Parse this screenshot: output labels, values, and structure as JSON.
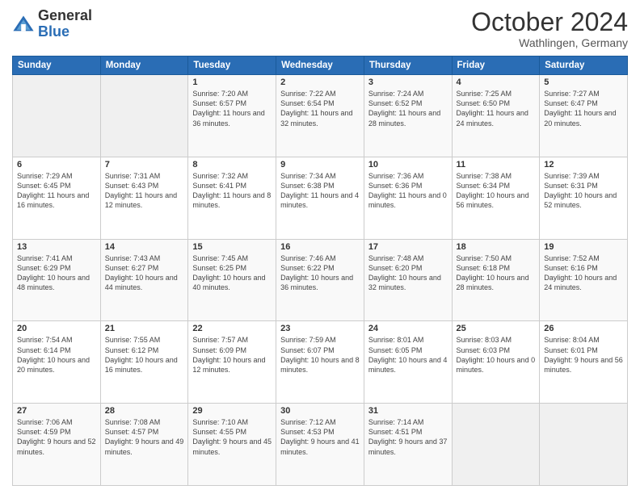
{
  "header": {
    "logo_general": "General",
    "logo_blue": "Blue",
    "month": "October 2024",
    "location": "Wathlingen, Germany"
  },
  "days_of_week": [
    "Sunday",
    "Monday",
    "Tuesday",
    "Wednesday",
    "Thursday",
    "Friday",
    "Saturday"
  ],
  "weeks": [
    [
      {
        "day": "",
        "info": ""
      },
      {
        "day": "",
        "info": ""
      },
      {
        "day": "1",
        "info": "Sunrise: 7:20 AM\nSunset: 6:57 PM\nDaylight: 11 hours and 36 minutes."
      },
      {
        "day": "2",
        "info": "Sunrise: 7:22 AM\nSunset: 6:54 PM\nDaylight: 11 hours and 32 minutes."
      },
      {
        "day": "3",
        "info": "Sunrise: 7:24 AM\nSunset: 6:52 PM\nDaylight: 11 hours and 28 minutes."
      },
      {
        "day": "4",
        "info": "Sunrise: 7:25 AM\nSunset: 6:50 PM\nDaylight: 11 hours and 24 minutes."
      },
      {
        "day": "5",
        "info": "Sunrise: 7:27 AM\nSunset: 6:47 PM\nDaylight: 11 hours and 20 minutes."
      }
    ],
    [
      {
        "day": "6",
        "info": "Sunrise: 7:29 AM\nSunset: 6:45 PM\nDaylight: 11 hours and 16 minutes."
      },
      {
        "day": "7",
        "info": "Sunrise: 7:31 AM\nSunset: 6:43 PM\nDaylight: 11 hours and 12 minutes."
      },
      {
        "day": "8",
        "info": "Sunrise: 7:32 AM\nSunset: 6:41 PM\nDaylight: 11 hours and 8 minutes."
      },
      {
        "day": "9",
        "info": "Sunrise: 7:34 AM\nSunset: 6:38 PM\nDaylight: 11 hours and 4 minutes."
      },
      {
        "day": "10",
        "info": "Sunrise: 7:36 AM\nSunset: 6:36 PM\nDaylight: 11 hours and 0 minutes."
      },
      {
        "day": "11",
        "info": "Sunrise: 7:38 AM\nSunset: 6:34 PM\nDaylight: 10 hours and 56 minutes."
      },
      {
        "day": "12",
        "info": "Sunrise: 7:39 AM\nSunset: 6:31 PM\nDaylight: 10 hours and 52 minutes."
      }
    ],
    [
      {
        "day": "13",
        "info": "Sunrise: 7:41 AM\nSunset: 6:29 PM\nDaylight: 10 hours and 48 minutes."
      },
      {
        "day": "14",
        "info": "Sunrise: 7:43 AM\nSunset: 6:27 PM\nDaylight: 10 hours and 44 minutes."
      },
      {
        "day": "15",
        "info": "Sunrise: 7:45 AM\nSunset: 6:25 PM\nDaylight: 10 hours and 40 minutes."
      },
      {
        "day": "16",
        "info": "Sunrise: 7:46 AM\nSunset: 6:22 PM\nDaylight: 10 hours and 36 minutes."
      },
      {
        "day": "17",
        "info": "Sunrise: 7:48 AM\nSunset: 6:20 PM\nDaylight: 10 hours and 32 minutes."
      },
      {
        "day": "18",
        "info": "Sunrise: 7:50 AM\nSunset: 6:18 PM\nDaylight: 10 hours and 28 minutes."
      },
      {
        "day": "19",
        "info": "Sunrise: 7:52 AM\nSunset: 6:16 PM\nDaylight: 10 hours and 24 minutes."
      }
    ],
    [
      {
        "day": "20",
        "info": "Sunrise: 7:54 AM\nSunset: 6:14 PM\nDaylight: 10 hours and 20 minutes."
      },
      {
        "day": "21",
        "info": "Sunrise: 7:55 AM\nSunset: 6:12 PM\nDaylight: 10 hours and 16 minutes."
      },
      {
        "day": "22",
        "info": "Sunrise: 7:57 AM\nSunset: 6:09 PM\nDaylight: 10 hours and 12 minutes."
      },
      {
        "day": "23",
        "info": "Sunrise: 7:59 AM\nSunset: 6:07 PM\nDaylight: 10 hours and 8 minutes."
      },
      {
        "day": "24",
        "info": "Sunrise: 8:01 AM\nSunset: 6:05 PM\nDaylight: 10 hours and 4 minutes."
      },
      {
        "day": "25",
        "info": "Sunrise: 8:03 AM\nSunset: 6:03 PM\nDaylight: 10 hours and 0 minutes."
      },
      {
        "day": "26",
        "info": "Sunrise: 8:04 AM\nSunset: 6:01 PM\nDaylight: 9 hours and 56 minutes."
      }
    ],
    [
      {
        "day": "27",
        "info": "Sunrise: 7:06 AM\nSunset: 4:59 PM\nDaylight: 9 hours and 52 minutes."
      },
      {
        "day": "28",
        "info": "Sunrise: 7:08 AM\nSunset: 4:57 PM\nDaylight: 9 hours and 49 minutes."
      },
      {
        "day": "29",
        "info": "Sunrise: 7:10 AM\nSunset: 4:55 PM\nDaylight: 9 hours and 45 minutes."
      },
      {
        "day": "30",
        "info": "Sunrise: 7:12 AM\nSunset: 4:53 PM\nDaylight: 9 hours and 41 minutes."
      },
      {
        "day": "31",
        "info": "Sunrise: 7:14 AM\nSunset: 4:51 PM\nDaylight: 9 hours and 37 minutes."
      },
      {
        "day": "",
        "info": ""
      },
      {
        "day": "",
        "info": ""
      }
    ]
  ]
}
